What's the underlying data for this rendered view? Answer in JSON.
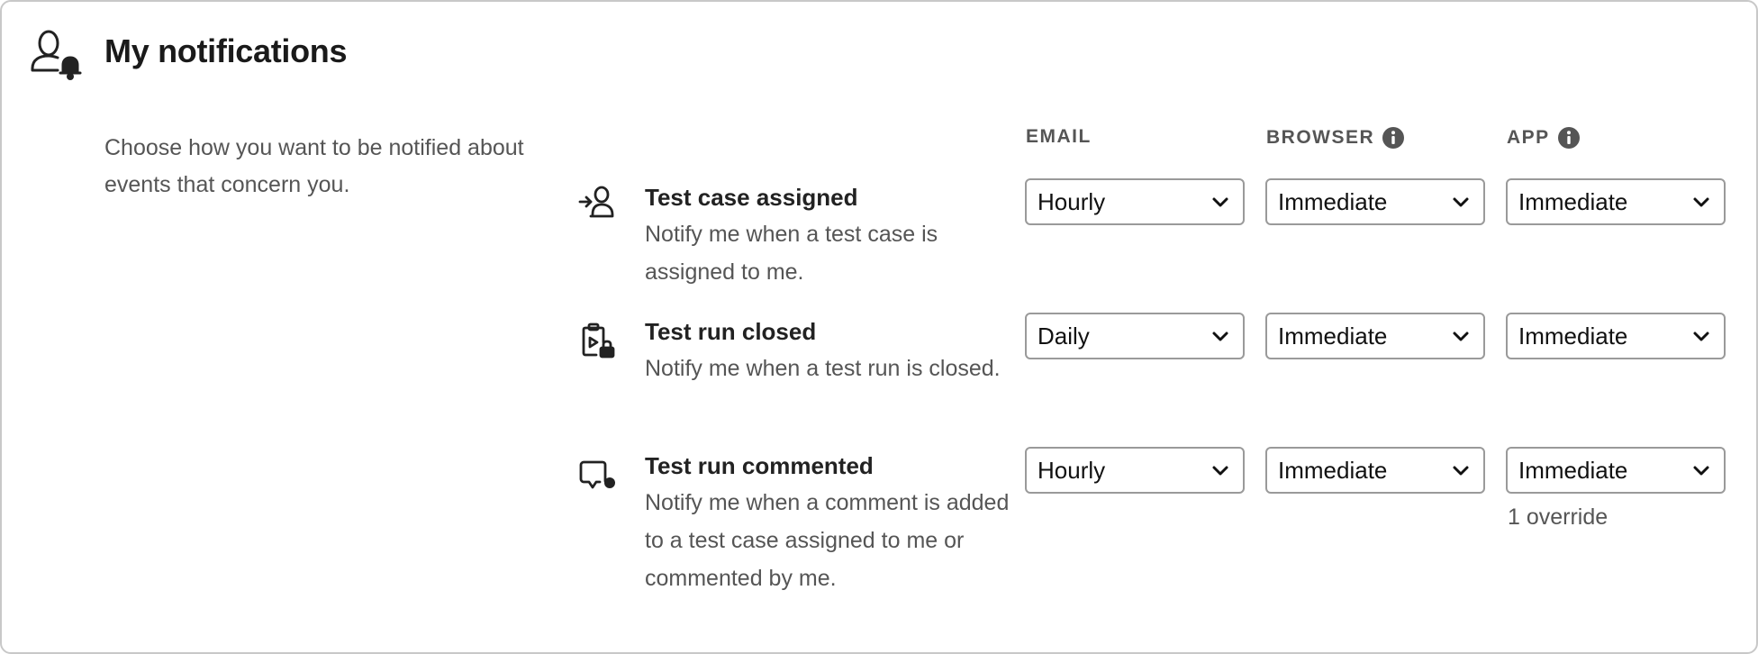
{
  "header": {
    "title": "My notifications",
    "icon": "user-bell-icon"
  },
  "intro": "Choose how you want to be notified about events that concern you.",
  "columns": {
    "email": "EMAIL",
    "browser": "BROWSER",
    "app": "APP"
  },
  "events": [
    {
      "icon": "user-assign-icon",
      "title": "Test case assigned",
      "description": "Notify me when a test case is assigned to me.",
      "email": "Hourly",
      "browser": "Immediate",
      "app": "Immediate"
    },
    {
      "icon": "clipboard-lock-icon",
      "title": "Test run closed",
      "description": "Notify me when a test run is closed.",
      "email": "Daily",
      "browser": "Immediate",
      "app": "Immediate"
    },
    {
      "icon": "comment-dot-icon",
      "title": "Test run commented",
      "description": "Notify me when a comment is added to a test case assigned to me or commented by me.",
      "email": "Hourly",
      "browser": "Immediate",
      "app": "Immediate",
      "app_note": "1 override"
    }
  ]
}
